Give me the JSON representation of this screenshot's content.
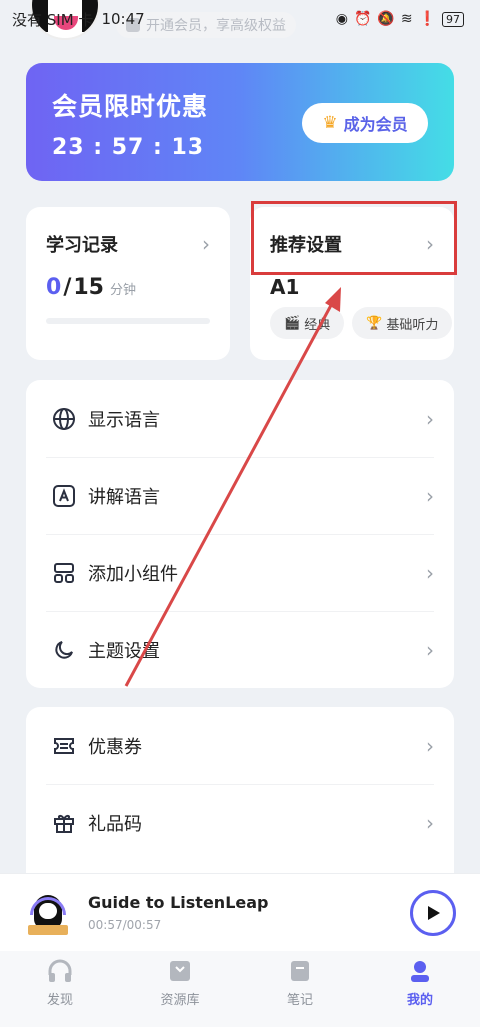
{
  "status_bar": {
    "carrier": "没有 SIM 卡",
    "time": "10:47",
    "battery": "97"
  },
  "promo_hint": "开通会员，享高级权益",
  "member": {
    "title": "会员限时优惠",
    "timer": "23 : 57 : 13",
    "button_label": "成为会员"
  },
  "study_card": {
    "title": "学习记录",
    "current": "0",
    "separator": "/",
    "total": "15",
    "unit": "分钟",
    "progress": 0
  },
  "recommend_card": {
    "title": "推荐设置",
    "level": "A1",
    "tags": [
      "经典",
      "基础听力"
    ]
  },
  "settings": {
    "items": [
      {
        "label": "显示语言"
      },
      {
        "label": "讲解语言"
      },
      {
        "label": "添加小组件"
      },
      {
        "label": "主题设置"
      }
    ]
  },
  "extras": {
    "items": [
      {
        "label": "优惠券"
      },
      {
        "label": "礼品码"
      }
    ]
  },
  "player": {
    "title": "Guide to ListenLeap",
    "time": "00:57/00:57"
  },
  "nav": {
    "items": [
      {
        "label": "发现"
      },
      {
        "label": "资源库"
      },
      {
        "label": "笔记"
      },
      {
        "label": "我的"
      }
    ],
    "active": "我的"
  },
  "colors": {
    "accent": "#5b5ff0",
    "annotation": "#d93c3c"
  }
}
